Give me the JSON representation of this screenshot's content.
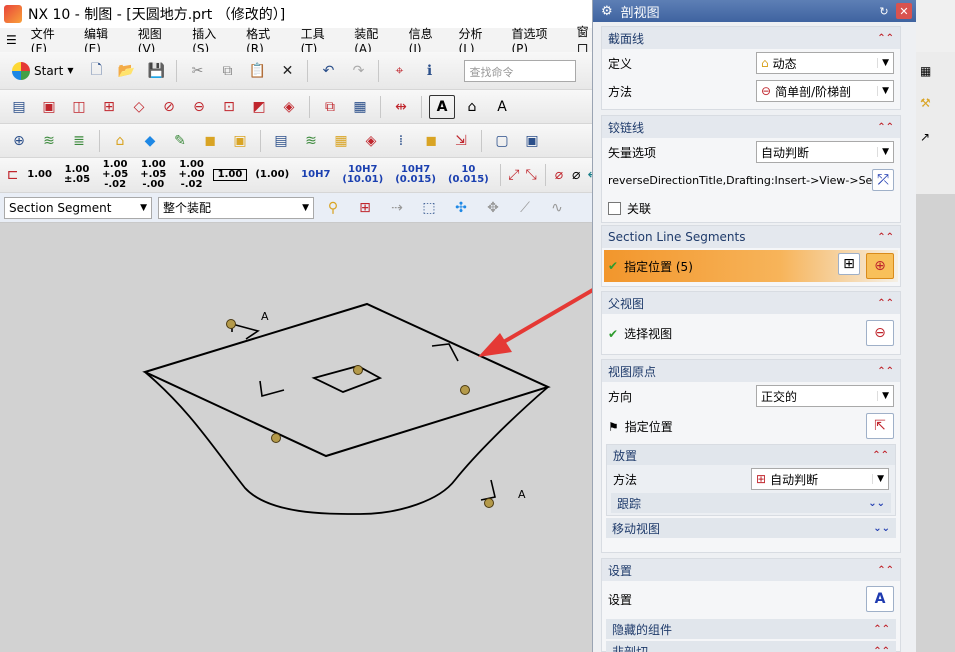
{
  "window": {
    "title": "NX 10 - 制图 - [天圆地方.prt （修改的）]"
  },
  "menu": [
    "文件(F)",
    "编辑(E)",
    "视图(V)",
    "插入(S)",
    "格式(R)",
    "工具(T)",
    "装配(A)",
    "信息(I)",
    "分析(L)",
    "首选项(P)",
    "窗口"
  ],
  "toolbar": {
    "start_label": "Start",
    "search_placeholder": "查找命令",
    "tolerances": [
      {
        "top": "1.00",
        "bottom": ""
      },
      {
        "top": "1.00",
        "bottom": "±.05"
      },
      {
        "top": "1.00",
        "bottom": "+.05 -.02"
      },
      {
        "top": "1.00",
        "bottom": "+.05 -.00"
      },
      {
        "top": "1.00",
        "bottom": "+.00 -.02"
      },
      {
        "top": "1.00",
        "bottom": ""
      },
      {
        "top": "(1.00)",
        "bottom": ""
      },
      {
        "top": "10H7",
        "bottom": ""
      },
      {
        "top": "10H7",
        "bottom": "(10.01)"
      },
      {
        "top": "10H7",
        "bottom": "(0.015)"
      },
      {
        "top": "10",
        "bottom": "(0.015)"
      }
    ]
  },
  "selection_bar": {
    "filter": "Section Segment",
    "scope": "整个装配"
  },
  "canvas": {
    "labels": [
      "A",
      "A"
    ]
  },
  "dialog": {
    "title": "剖视图",
    "sections": {
      "cut_line": {
        "title": "截面线",
        "define_label": "定义",
        "define_value": "动态",
        "method_label": "方法",
        "method_value": "简单剖/阶梯剖"
      },
      "hinge_line": {
        "title": "铰链线",
        "vector_label": "矢量选项",
        "vector_value": "自动判断",
        "reverse_text": "reverseDirectionTitle,Drafting:Insert->View->Se",
        "associate_label": "关联"
      },
      "segments": {
        "title": "Section Line Segments",
        "specify_label": "指定位置 (5)"
      },
      "parent_view": {
        "title": "父视图",
        "select_label": "选择视图"
      },
      "view_origin": {
        "title": "视图原点",
        "direction_label": "方向",
        "direction_value": "正交的",
        "specify_label": "指定位置",
        "placement_title": "放置",
        "placement_method_label": "方法",
        "placement_method_value": "自动判断",
        "track_label": "跟踪",
        "move_view_label": "移动视图"
      },
      "settings": {
        "title": "设置",
        "settings_label": "设置",
        "hidden_components_label": "隐藏的组件",
        "non_section_label": "非剖切"
      }
    }
  },
  "colors": {
    "accent": "#f2962c",
    "dialog_title": "#3f63a0",
    "canvas": "#d2d2d2",
    "arrow": "#e53935"
  }
}
